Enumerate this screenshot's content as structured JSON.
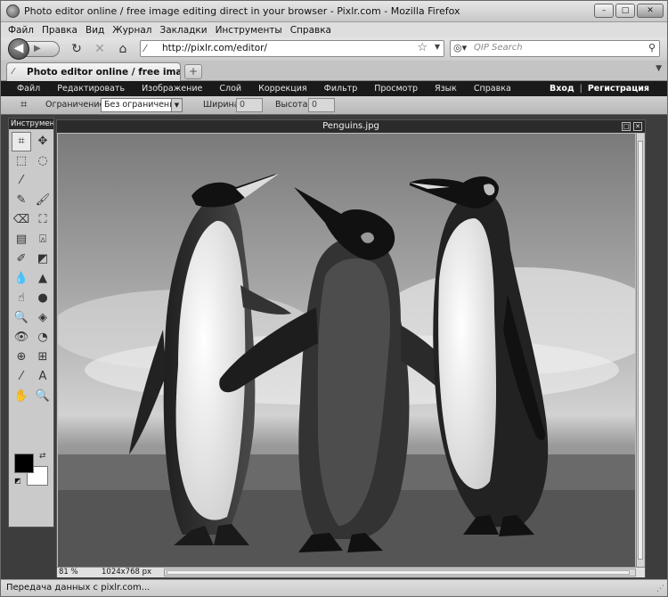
{
  "window": {
    "title": "Photo editor online / free image editing direct in your browser - Pixlr.com - Mozilla Firefox",
    "minimize": "–",
    "maximize": "□",
    "close": "✕"
  },
  "browser_menu": [
    "Файл",
    "Правка",
    "Вид",
    "Журнал",
    "Закладки",
    "Инструменты",
    "Справка"
  ],
  "navbar": {
    "back": "◀",
    "forward": "▶",
    "reload": "↻",
    "stop": "✕",
    "home": "⌂",
    "url": "http://pixlr.com/editor/",
    "search_placeholder": "QIP Search"
  },
  "tab": {
    "label": "Photo editor online / free image editi...",
    "new_tab": "+"
  },
  "app_menu": {
    "items": [
      "Файл",
      "Редактировать",
      "Изображение",
      "Слой",
      "Коррекция",
      "Фильтр",
      "Просмотр",
      "Язык",
      "Справка"
    ],
    "login": "Вход",
    "separator": "|",
    "register": "Регистрация"
  },
  "options": {
    "constraint_label": "Ограничение:",
    "constraint_value": "Без ограничения",
    "width_label": "Ширина:",
    "width_value": "0",
    "height_label": "Высота:",
    "height_value": "0"
  },
  "tools": {
    "title": "Инструменты",
    "items": [
      {
        "name": "crop-tool-icon",
        "glyph": "⌗"
      },
      {
        "name": "move-tool-icon",
        "glyph": "✥"
      },
      {
        "name": "marquee-tool-icon",
        "glyph": "⬚"
      },
      {
        "name": "lasso-tool-icon",
        "glyph": "◌"
      },
      {
        "name": "wand-tool-icon",
        "glyph": "⁄"
      },
      {
        "name": "blank-tool-icon",
        "glyph": ""
      },
      {
        "name": "pencil-tool-icon",
        "glyph": "✎"
      },
      {
        "name": "brush-tool-icon",
        "glyph": "🖌"
      },
      {
        "name": "eraser-tool-icon",
        "glyph": "⌫"
      },
      {
        "name": "bucket-tool-icon",
        "glyph": "⛶"
      },
      {
        "name": "gradient-tool-icon",
        "glyph": "▤"
      },
      {
        "name": "stamp-tool-icon",
        "glyph": "⍓"
      },
      {
        "name": "color-replace-tool-icon",
        "glyph": "✐"
      },
      {
        "name": "drawing-tool-icon",
        "glyph": "◩"
      },
      {
        "name": "blur-tool-icon",
        "glyph": "💧"
      },
      {
        "name": "sharpen-tool-icon",
        "glyph": "▲"
      },
      {
        "name": "smudge-tool-icon",
        "glyph": "☝"
      },
      {
        "name": "sponge-tool-icon",
        "glyph": "●"
      },
      {
        "name": "dodge-tool-icon",
        "glyph": "🔍"
      },
      {
        "name": "burn-tool-icon",
        "glyph": "◈"
      },
      {
        "name": "red-eye-tool-icon",
        "glyph": "👁"
      },
      {
        "name": "spot-heal-tool-icon",
        "glyph": "◔"
      },
      {
        "name": "bloat-tool-icon",
        "glyph": "⊕"
      },
      {
        "name": "pinch-tool-icon",
        "glyph": "⊞"
      },
      {
        "name": "eyedropper-tool-icon",
        "glyph": "⁄"
      },
      {
        "name": "text-tool-icon",
        "glyph": "A"
      },
      {
        "name": "hand-tool-icon",
        "glyph": "✋"
      },
      {
        "name": "zoom-tool-icon",
        "glyph": "🔍"
      }
    ],
    "foreground_color": "#000000",
    "background_color": "#ffffff"
  },
  "document": {
    "name": "Penguins.jpg",
    "zoom": "81 %",
    "dimensions": "1024x768 px"
  },
  "status": {
    "text": "Передача данных с pixlr.com..."
  }
}
